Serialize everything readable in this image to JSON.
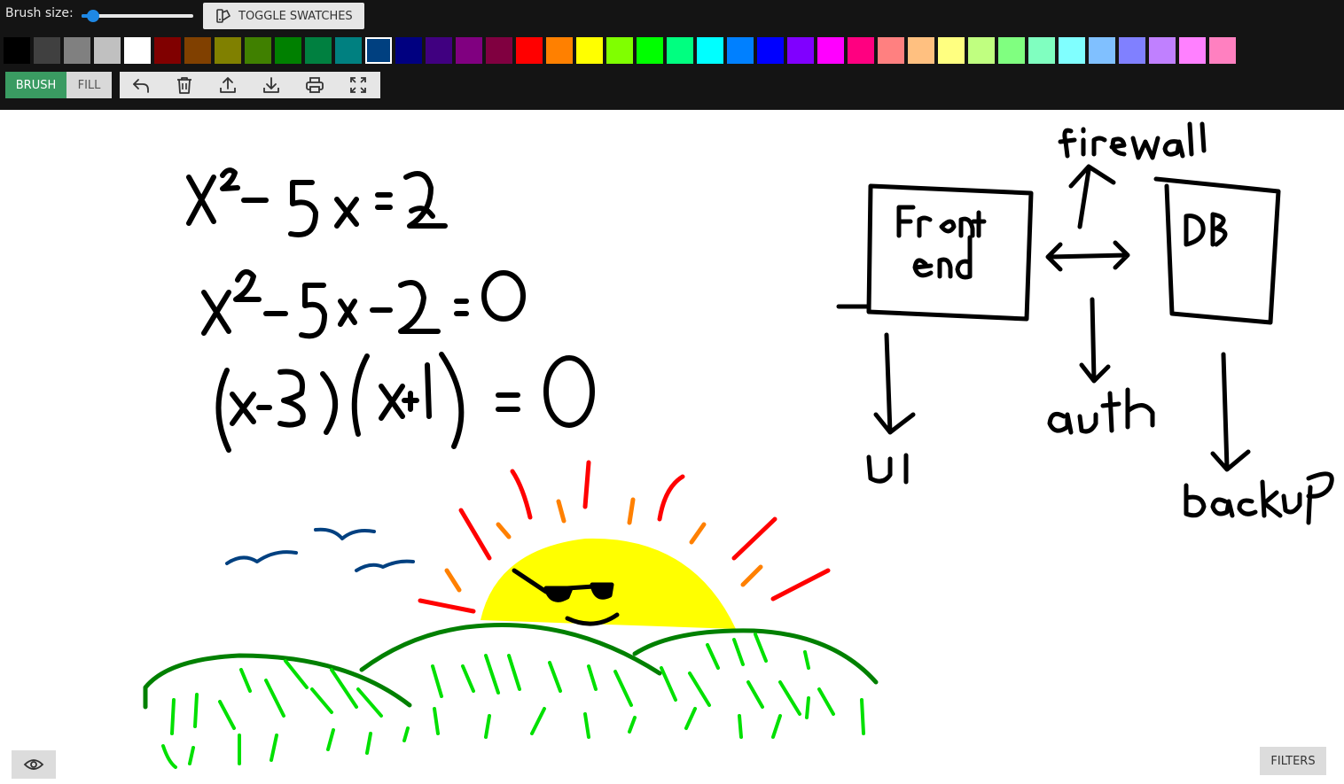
{
  "toolbar": {
    "brush_size_label": "Brush size:",
    "brush_size": 0.1,
    "toggle_swatches_label": "TOGGLE SWATCHES",
    "toggle_swatches_icon": "palette-icon",
    "modes": {
      "brush_label": "BRUSH",
      "fill_label": "FILL",
      "active": "BRUSH"
    },
    "actions": [
      {
        "name": "undo",
        "icon": "undo-icon"
      },
      {
        "name": "clear",
        "icon": "trash-icon"
      },
      {
        "name": "upload",
        "icon": "upload-icon"
      },
      {
        "name": "download",
        "icon": "download-icon"
      },
      {
        "name": "print",
        "icon": "print-icon"
      },
      {
        "name": "fullscreen",
        "icon": "fullscreen-icon"
      }
    ]
  },
  "swatches": {
    "selected_index": 12,
    "colors": [
      "#000000",
      "#404040",
      "#808080",
      "#c0c0c0",
      "#ffffff",
      "#800000",
      "#804000",
      "#808000",
      "#408000",
      "#008000",
      "#008040",
      "#008080",
      "#004080",
      "#000080",
      "#400080",
      "#800080",
      "#800040",
      "#ff0000",
      "#ff8000",
      "#ffff00",
      "#80ff00",
      "#00ff00",
      "#00ff80",
      "#00ffff",
      "#0080ff",
      "#0000ff",
      "#8000ff",
      "#ff00ff",
      "#ff0080",
      "#ff8080",
      "#ffc080",
      "#ffff80",
      "#c0ff80",
      "#80ff80",
      "#80ffc0",
      "#80ffff",
      "#80c0ff",
      "#8080ff",
      "#c080ff",
      "#ff80ff",
      "#ff80c0"
    ]
  },
  "canvas": {
    "math_texts": [
      "x²–5x=2",
      "x²–5x–2=0",
      "(x-3)(x+1)=0"
    ],
    "diagram_labels": [
      "Front end",
      "DB",
      "firewall",
      "auth",
      "UI",
      "backup"
    ]
  },
  "bottom": {
    "visibility_icon": "eye-icon",
    "filters_label": "FILTERS"
  },
  "colors": {
    "toolbar_bg": "#141414",
    "brush_active": "#3a9b62",
    "ink": "#000000",
    "sun": "#ffff00",
    "hill_outline": "#008000",
    "grass": "#00e000",
    "ray_red": "#ff0000",
    "ray_orange": "#ff8000",
    "bird": "#004080"
  }
}
